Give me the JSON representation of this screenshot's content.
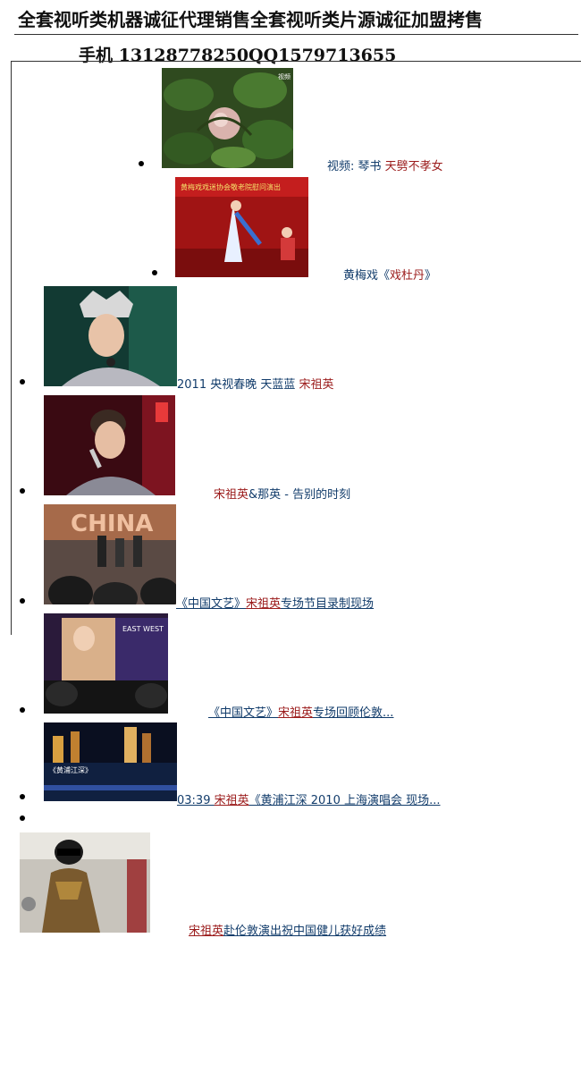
{
  "header": {
    "title": "全套视听类机器诚征代理销售全套视听类片源诚征加盟拷售",
    "contact": "手机 13128778250QQ1579713655"
  },
  "items": [
    {
      "thumb": "flower-thumbnail",
      "parts": [
        "视频: 琴书 ",
        "天劈不孝女"
      ]
    },
    {
      "thumb": "opera-stage-thumbnail",
      "parts": [
        "黄梅戏《",
        "戏杜丹",
        "》"
      ]
    },
    {
      "thumb": "singer-crown-thumbnail",
      "parts": [
        "2011 央视春晚 天蓝蓝 ",
        "宋祖英"
      ]
    },
    {
      "thumb": "singer-mic-thumbnail",
      "parts": [
        "宋祖英",
        "&那英 - 告别的时刻"
      ]
    },
    {
      "thumb": "stage-crowd-thumbnail",
      "parts": [
        "《中国文艺》",
        "宋祖英",
        "专场节目录制现场"
      ]
    },
    {
      "thumb": "london-stage-thumbnail",
      "parts": [
        "《中国文艺》",
        "宋祖英",
        "专场回顾伦敦..."
      ]
    },
    {
      "thumb": "night-river-thumbnail",
      "parts": [
        "03:39 ",
        "宋祖英",
        "《黄浦江深 2010 上海演唱会 现场..."
      ]
    },
    {
      "thumb": "airport-thumbnail",
      "parts": [
        "宋祖英",
        "赴伦敦演出祝中国健儿获好成绩"
      ]
    }
  ]
}
